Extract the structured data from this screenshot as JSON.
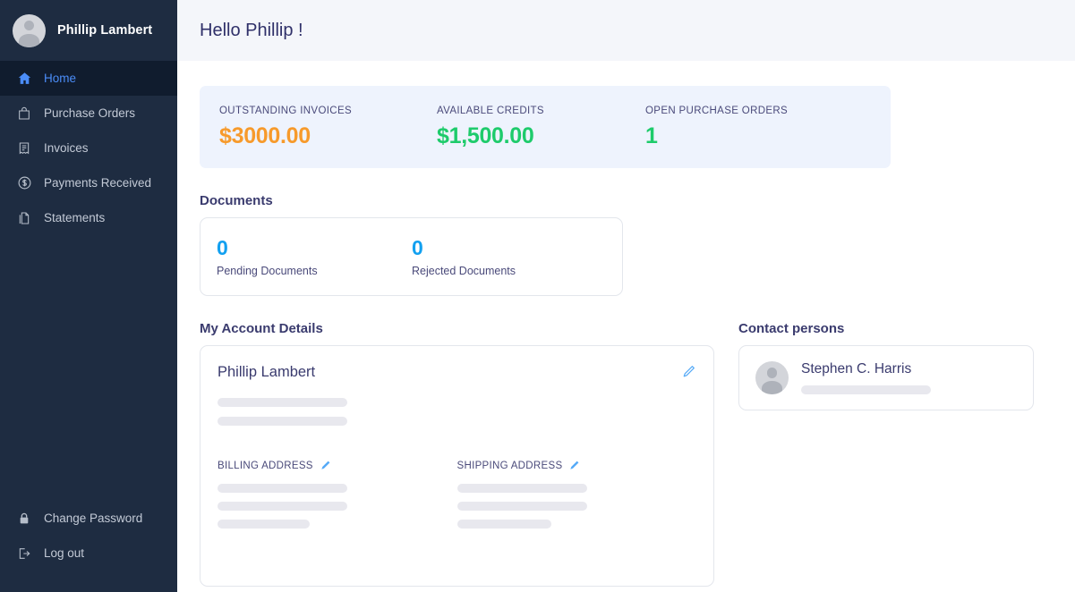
{
  "sidebar": {
    "user": {
      "name": "Phillip Lambert",
      "avatar_icon": "user-avatar-icon"
    },
    "items": [
      {
        "label": "Home",
        "icon": "home-icon",
        "active": true
      },
      {
        "label": "Purchase Orders",
        "icon": "shopping-bag-icon",
        "active": false
      },
      {
        "label": "Invoices",
        "icon": "receipt-icon",
        "active": false
      },
      {
        "label": "Payments Received",
        "icon": "dollar-circle-icon",
        "active": false
      },
      {
        "label": "Statements",
        "icon": "document-copy-icon",
        "active": false
      }
    ],
    "bottom_items": [
      {
        "label": "Change Password",
        "icon": "lock-icon"
      },
      {
        "label": "Log out",
        "icon": "logout-icon"
      }
    ]
  },
  "header": {
    "greeting": "Hello Phillip !"
  },
  "stats": [
    {
      "label": "OUTSTANDING INVOICES",
      "value": "$3000.00",
      "color": "#f79a2b"
    },
    {
      "label": "AVAILABLE CREDITS",
      "value": "$1,500.00",
      "color": "#1ecb6b"
    },
    {
      "label": "OPEN PURCHASE ORDERS",
      "value": "1",
      "color": "#1ecb6b"
    }
  ],
  "documents": {
    "title": "Documents",
    "items": [
      {
        "count": "0",
        "label": "Pending Documents"
      },
      {
        "count": "0",
        "label": "Rejected Documents"
      }
    ]
  },
  "account": {
    "title": "My Account Details",
    "name": "Phillip Lambert",
    "edit_icon": "pencil-icon",
    "billing": {
      "label": "BILLING ADDRESS",
      "edit_icon": "pencil-icon"
    },
    "shipping": {
      "label": "SHIPPING ADDRESS",
      "edit_icon": "pencil-icon"
    }
  },
  "contacts": {
    "title": "Contact persons",
    "persons": [
      {
        "name": "Stephen C. Harris",
        "avatar_icon": "user-avatar-icon"
      }
    ]
  },
  "colors": {
    "sidebar_bg": "#1e2c41",
    "accent_blue": "#4b8df8",
    "doc_blue": "#12a0f0",
    "orange": "#f79a2b",
    "green": "#1ecb6b"
  }
}
